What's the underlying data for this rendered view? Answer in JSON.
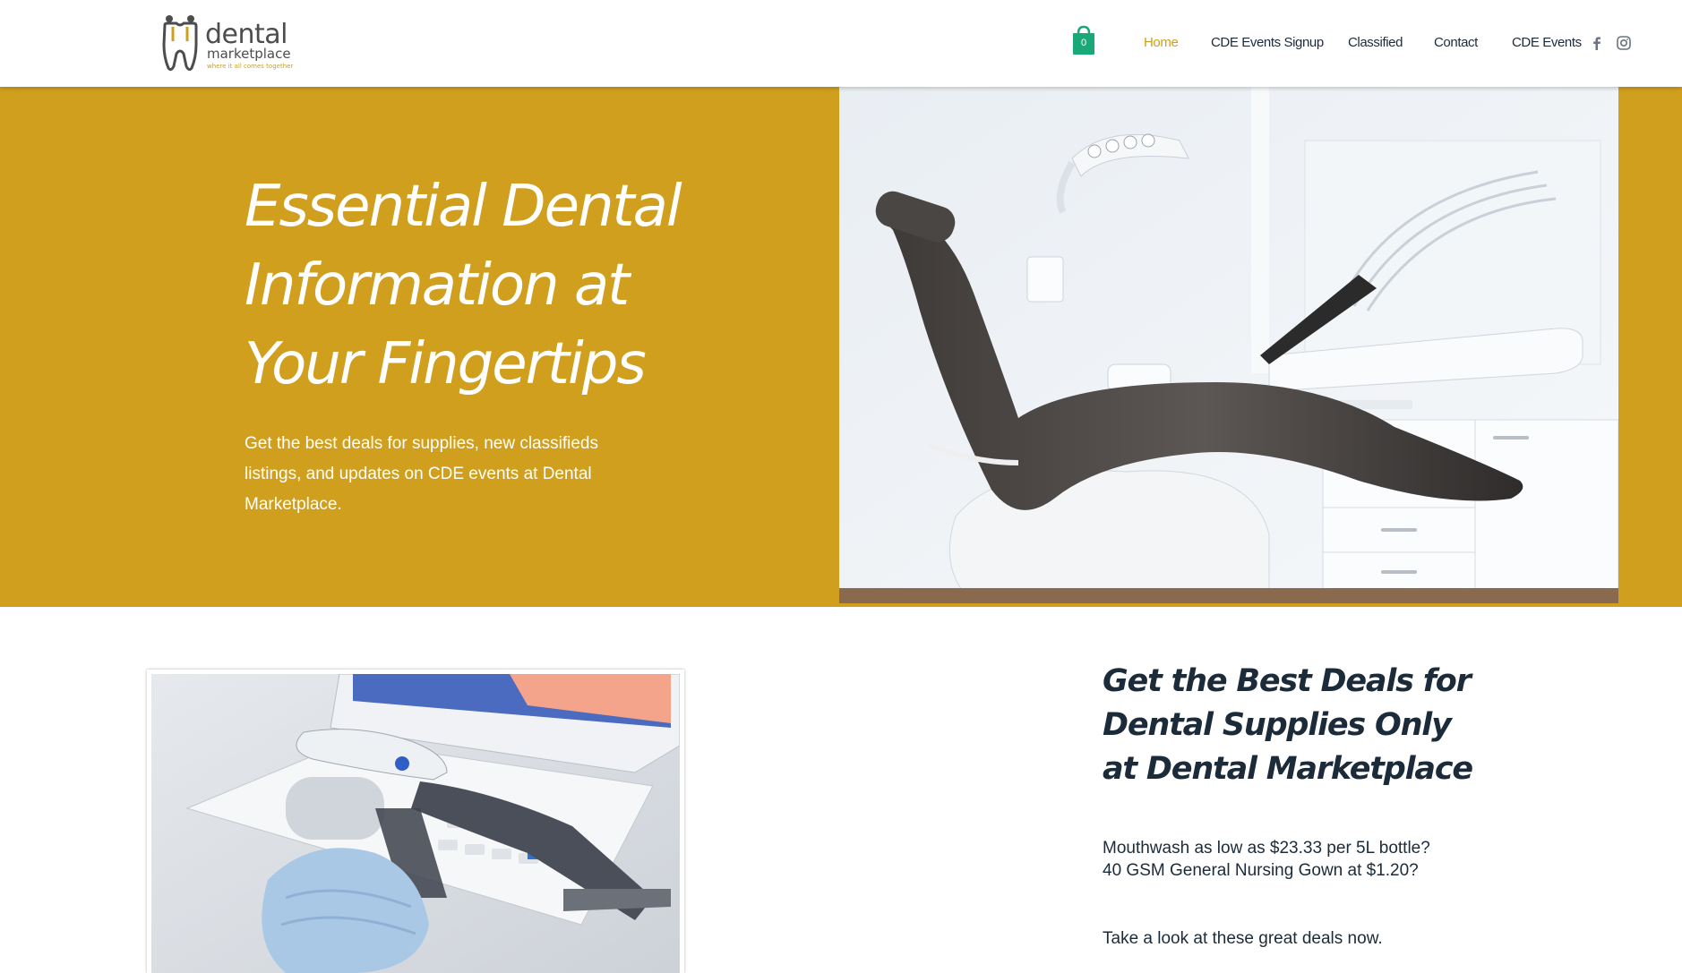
{
  "brand": {
    "name": "dental",
    "subname": "marketplace",
    "tagline": "where it all comes together"
  },
  "cart": {
    "count": "0",
    "color": "#19a979"
  },
  "nav": {
    "items": [
      {
        "label": "Home",
        "active": true
      },
      {
        "label": "CDE Events Signup",
        "active": false
      },
      {
        "label": "Classified",
        "active": false
      },
      {
        "label": "Contact",
        "active": false
      },
      {
        "label": "CDE Events",
        "active": false
      }
    ],
    "social": [
      "facebook-icon",
      "instagram-icon"
    ]
  },
  "hero": {
    "title_lines": [
      "Essential Dental",
      "Information at",
      "Your Fingertips"
    ],
    "subtitle": "Get the best deals for supplies, new classifieds listings, and updates on CDE events at Dental Marketplace.",
    "background_color": "#d19f1e",
    "image": "dental-chair-photo"
  },
  "deals": {
    "image": "intraoral-scanner-photo",
    "title_lines": [
      "Get the Best Deals for",
      "Dental Supplies Only",
      "at Dental Marketplace"
    ],
    "paragraph1": "Mouthwash as low as $23.33 per 5L bottle? 40 GSM General Nursing Gown at $1.20?",
    "paragraph2": "Take a look at these great deals now."
  },
  "colors": {
    "accent": "#d19f1e",
    "text": "#1c2b3a",
    "white": "#ffffff"
  }
}
